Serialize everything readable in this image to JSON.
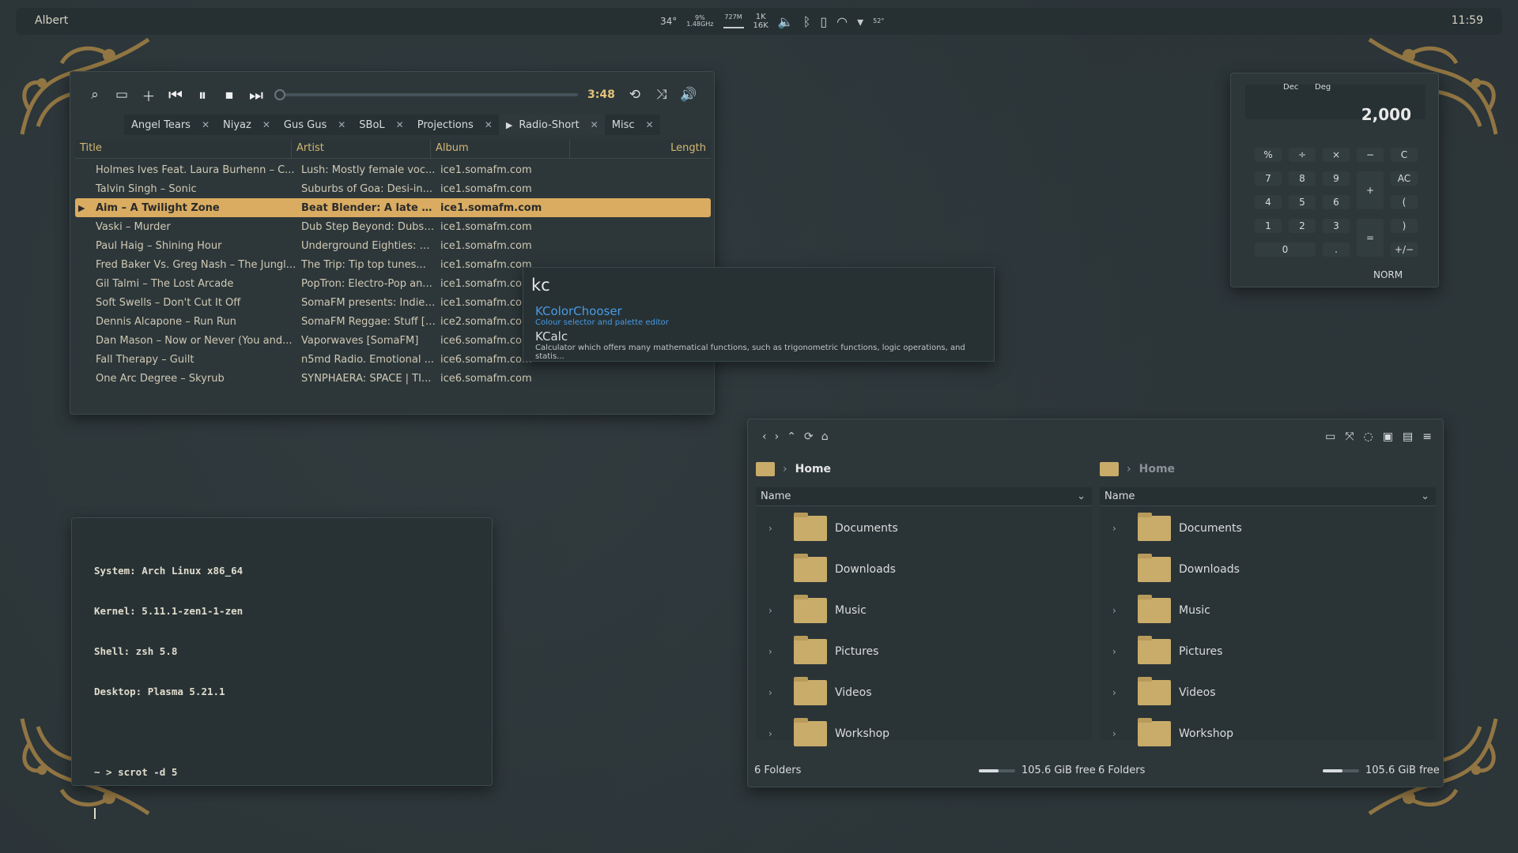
{
  "panel": {
    "app_name": "Albert",
    "clock": "11:59",
    "tray": {
      "cpu_temp": "34°",
      "cpu_freq": "1.48GHz",
      "cpu_load": "9%",
      "mem": "727M",
      "net_up": "1K",
      "net_down": "16K",
      "gpu_temp": "52°"
    }
  },
  "player": {
    "time": "3:48",
    "tabs": [
      {
        "label": "Angel Tears",
        "active": false
      },
      {
        "label": "Niyaz",
        "active": false
      },
      {
        "label": "Gus Gus",
        "active": false
      },
      {
        "label": "SBoL",
        "active": false
      },
      {
        "label": "Projections",
        "active": false
      },
      {
        "label": "Radio-Short",
        "active": true
      },
      {
        "label": "Misc",
        "active": false
      }
    ],
    "columns": {
      "title": "Title",
      "artist": "Artist",
      "album": "Album",
      "length": "Length"
    },
    "rows": [
      {
        "title": "Holmes Ives Feat. Laura Burhenn – C...",
        "artist": "Lush: Mostly female voc...",
        "album": "ice1.somafm.com"
      },
      {
        "title": "Talvin Singh – Sonic",
        "artist": "Suburbs of Goa: Desi-in...",
        "album": "ice1.somafm.com"
      },
      {
        "title": "Aim – A Twilight Zone",
        "artist": "Beat Blender: A late n...",
        "album": "ice1.somafm.com",
        "playing": true
      },
      {
        "title": "Vaski – Murder",
        "artist": "Dub Step Beyond: Dubst...",
        "album": "ice1.somafm.com"
      },
      {
        "title": "Paul Haig – Shining Hour",
        "artist": "Underground Eighties: U...",
        "album": "ice1.somafm.com"
      },
      {
        "title": "Fred Baker Vs. Greg Nash – The Jungl...",
        "artist": "The Trip:  Tip top tunes...",
        "album": "ice1.somafm.com"
      },
      {
        "title": "Gil Talmi – The Lost Arcade",
        "artist": "PopTron: Electro-Pop an...",
        "album": "ice1.somafm.com"
      },
      {
        "title": "Soft Swells – Don't Cut It Off",
        "artist": "SomaFM presents: Indie ...",
        "album": "ice1.somafm.com"
      },
      {
        "title": "Dennis Alcapone – Run Run",
        "artist": "SomaFM Reggae: Stuff [S...",
        "album": "ice2.somafm.com"
      },
      {
        "title": "Dan Mason – Now or Never (You and...",
        "artist": "Vaporwaves [SomaFM]",
        "album": "ice6.somafm.com"
      },
      {
        "title": "Fall Therapy – Guilt",
        "artist": "n5md Radio. Emotional ...",
        "album": "ice6.somafm.com"
      },
      {
        "title": "One Arc Degree – Skyrub",
        "artist": "SYNPHAERA: SPACE | TI...",
        "album": "ice6.somafm.com"
      }
    ]
  },
  "launcher": {
    "query": "kc",
    "results": [
      {
        "name": "KColorChooser",
        "desc": "Colour selector and palette editor"
      },
      {
        "name": "KCalc",
        "desc": "Calculator which offers many mathematical functions, such as trigonometric functions, logic operations, and statis..."
      }
    ]
  },
  "calculator": {
    "mode_base": "Dec",
    "mode_angle": "Deg",
    "value": "2,000",
    "status": "NORM",
    "keys": {
      "percent": "%",
      "divide": "÷",
      "multiply": "×",
      "minus": "−",
      "clear": "C",
      "k7": "7",
      "k8": "8",
      "k9": "9",
      "plus": "+",
      "all_clear": "AC",
      "k4": "4",
      "k5": "5",
      "k6": "6",
      "paren_open": "(",
      "k1": "1",
      "k2": "2",
      "k3": "3",
      "equals": "=",
      "paren_close": ")",
      "k0": "0",
      "dot": ".",
      "sign": "+/−"
    }
  },
  "terminal": {
    "lines": [
      "System: Arch Linux x86_64",
      "Kernel: 5.11.1-zen1-1-zen",
      "Shell: zsh 5.8",
      "Desktop: Plasma 5.21.1",
      "",
      "~ > scrot -d 5"
    ]
  },
  "files": {
    "left": {
      "location": "Home",
      "column": "Name",
      "items": [
        "Documents",
        "Downloads",
        "Music",
        "Pictures",
        "Videos",
        "Workshop"
      ],
      "expandable": [
        true,
        false,
        true,
        true,
        true,
        true
      ],
      "status": "6 Folders",
      "free": "105.6 GiB free",
      "used_fraction": 0.55
    },
    "right": {
      "location": "Home",
      "column": "Name",
      "items": [
        "Documents",
        "Downloads",
        "Music",
        "Pictures",
        "Videos",
        "Workshop"
      ],
      "expandable": [
        true,
        false,
        true,
        true,
        true,
        true
      ],
      "status": "6 Folders",
      "free": "105.6 GiB free",
      "used_fraction": 0.55
    }
  },
  "colors": {
    "accent": "#d9ac62",
    "launcher_highlight": "#4a9ae4",
    "folder": "#c9ac6a",
    "background": "#2b3437"
  }
}
